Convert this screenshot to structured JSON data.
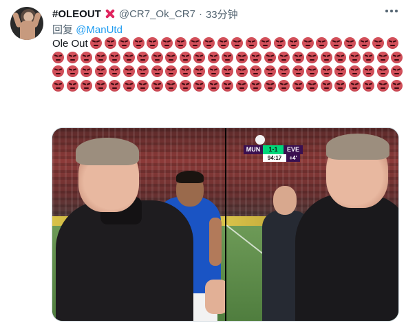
{
  "tweet": {
    "display_name": "#OLEOUT",
    "handle": "@CR7_Ok_CR7",
    "separator": "·",
    "time": "33分钟",
    "reply_prefix": "回复",
    "reply_to": "@ManUtd",
    "text": "Ole Out",
    "emoji_icon": "angry-face-icon",
    "emoji_count": 97
  },
  "scoreboard": {
    "home": "MUN",
    "score": "1-1",
    "away": "EVE",
    "clock": "94:17",
    "added": "+4'"
  },
  "colors": {
    "accent": "#1d9bf0",
    "cross": "#e0245e",
    "emoji": "#c9404c"
  }
}
